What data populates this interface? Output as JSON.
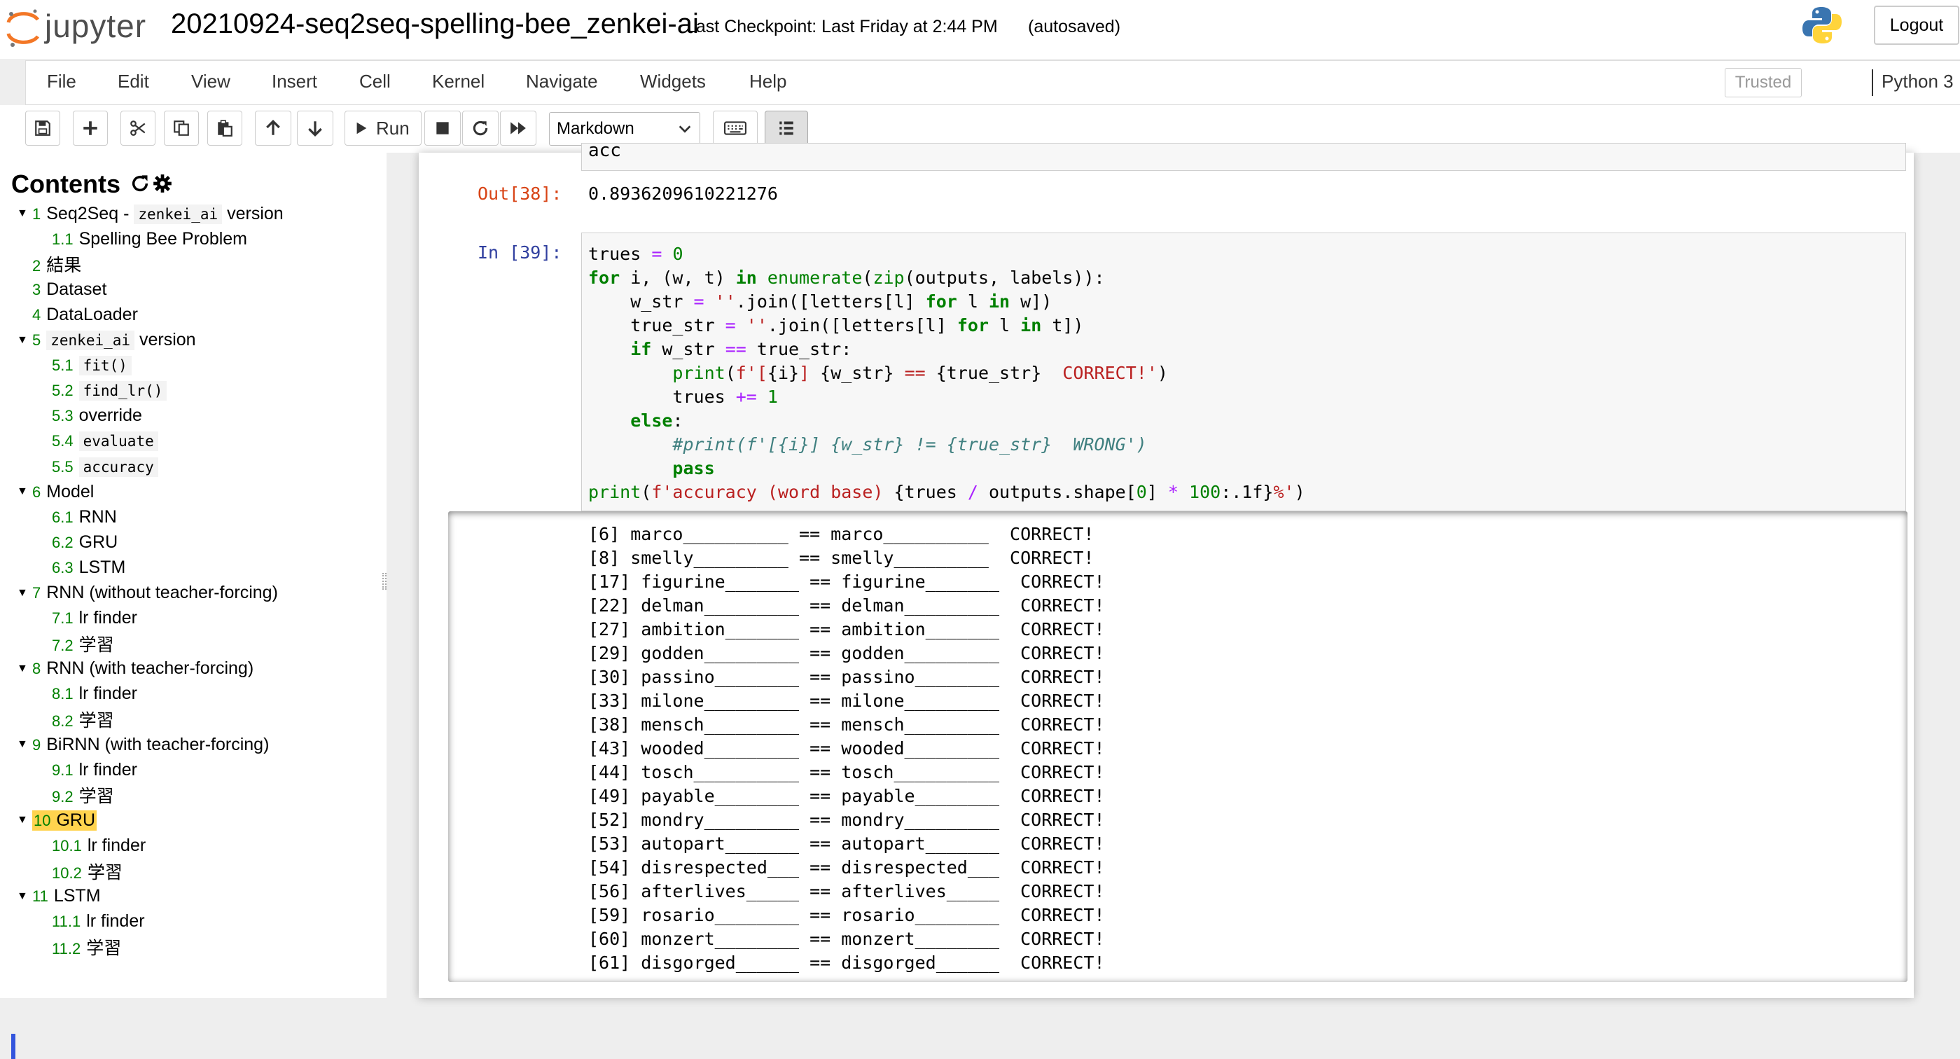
{
  "header": {
    "logo_text": "jupyter",
    "notebook_title": "20210924-seq2seq-spelling-bee_zenkei-ai",
    "checkpoint": "Last Checkpoint: Last Friday at 2:44 PM",
    "autosave": "(autosaved)",
    "logout_label": "Logout"
  },
  "menu": {
    "items": [
      "File",
      "Edit",
      "View",
      "Insert",
      "Cell",
      "Kernel",
      "Navigate",
      "Widgets",
      "Help"
    ],
    "trusted": "Trusted",
    "kernel": "Python 3"
  },
  "toolbar": {
    "run_label": "Run",
    "cell_type": "Markdown"
  },
  "toc": {
    "title": "Contents",
    "items": [
      {
        "num": "1",
        "pre": "Seq2Seq - ",
        "code": "zenkei_ai",
        "post": " version",
        "caret": true
      },
      {
        "num": "1.1",
        "pre": "Spelling Bee Problem"
      },
      {
        "num": "2",
        "pre": "結果"
      },
      {
        "num": "3",
        "pre": "Dataset"
      },
      {
        "num": "4",
        "pre": "DataLoader"
      },
      {
        "num": "5",
        "code": "zenkei_ai",
        "post": " version",
        "caret": true
      },
      {
        "num": "5.1",
        "code": "fit()"
      },
      {
        "num": "5.2",
        "code": "find_lr()"
      },
      {
        "num": "5.3",
        "pre": "override"
      },
      {
        "num": "5.4",
        "code": "evaluate"
      },
      {
        "num": "5.5",
        "code": "accuracy"
      },
      {
        "num": "6",
        "pre": "Model",
        "caret": true
      },
      {
        "num": "6.1",
        "pre": "RNN"
      },
      {
        "num": "6.2",
        "pre": "GRU"
      },
      {
        "num": "6.3",
        "pre": "LSTM"
      },
      {
        "num": "7",
        "pre": "RNN (without teacher-forcing)",
        "caret": true
      },
      {
        "num": "7.1",
        "pre": "lr finder"
      },
      {
        "num": "7.2",
        "pre": "学習"
      },
      {
        "num": "8",
        "pre": "RNN (with teacher-forcing)",
        "caret": true
      },
      {
        "num": "8.1",
        "pre": "lr finder"
      },
      {
        "num": "8.2",
        "pre": "学習"
      },
      {
        "num": "9",
        "pre": "BiRNN (with teacher-forcing)",
        "caret": true
      },
      {
        "num": "9.1",
        "pre": "lr finder"
      },
      {
        "num": "9.2",
        "pre": "学習"
      },
      {
        "num": "10",
        "pre": "GRU",
        "caret": true,
        "highlight": true
      },
      {
        "num": "10.1",
        "pre": "lr finder"
      },
      {
        "num": "10.2",
        "pre": "学習"
      },
      {
        "num": "11",
        "pre": "LSTM",
        "caret": true
      },
      {
        "num": "11.1",
        "pre": "lr finder"
      },
      {
        "num": "11.2",
        "pre": "学習"
      }
    ]
  },
  "cells": {
    "prev_code": "acc",
    "out_prompt": "Out[38]:",
    "out_value": "0.8936209610221276",
    "in_prompt": "In [39]:",
    "output_lines": [
      "[6] marco__________ == marco__________  CORRECT!",
      "[8] smelly_________ == smelly_________  CORRECT!",
      "[17] figurine_______ == figurine_______  CORRECT!",
      "[22] delman_________ == delman_________  CORRECT!",
      "[27] ambition_______ == ambition_______  CORRECT!",
      "[29] godden_________ == godden_________  CORRECT!",
      "[30] passino________ == passino________  CORRECT!",
      "[33] milone_________ == milone_________  CORRECT!",
      "[38] mensch_________ == mensch_________  CORRECT!",
      "[43] wooded_________ == wooded_________  CORRECT!",
      "[44] tosch__________ == tosch__________  CORRECT!",
      "[49] payable________ == payable________  CORRECT!",
      "[52] mondry_________ == mondry_________  CORRECT!",
      "[53] autopart_______ == autopart_______  CORRECT!",
      "[54] disrespected___ == disrespected___  CORRECT!",
      "[56] afterlives_____ == afterlives_____  CORRECT!",
      "[59] rosario________ == rosario________  CORRECT!",
      "[60] monzert________ == monzert________  CORRECT!",
      "[61] disgorged______ == disgorged______  CORRECT!"
    ]
  },
  "colors": {
    "highlight": "#ffd34e",
    "out_prompt": "#d84315",
    "in_prompt": "#303f9f",
    "active_bar": "#3355dd"
  }
}
